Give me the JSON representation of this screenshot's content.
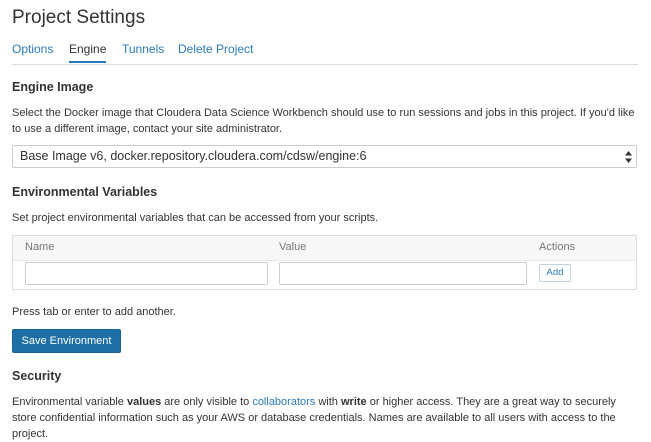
{
  "page": {
    "title": "Project Settings"
  },
  "tabs": [
    {
      "label": "Options",
      "active": false
    },
    {
      "label": "Engine",
      "active": true
    },
    {
      "label": "Tunnels",
      "active": false
    },
    {
      "label": "Delete Project",
      "active": false
    }
  ],
  "engine_image": {
    "heading": "Engine Image",
    "description": "Select the Docker image that Cloudera Data Science Workbench should use to run sessions and jobs in this project. If you'd like to use a different image, contact your site administrator.",
    "selected_value": "Base Image v6, docker.repository.cloudera.com/cdsw/engine:6"
  },
  "env_vars": {
    "heading": "Environmental Variables",
    "description": "Set project environmental variables that can be accessed from your scripts.",
    "columns": {
      "name": "Name",
      "value": "Value",
      "actions": "Actions"
    },
    "name_input_value": "",
    "value_input_value": "",
    "add_label": "Add",
    "hint": "Press tab or enter to add another.",
    "save_label": "Save Environment"
  },
  "security": {
    "heading": "Security",
    "text_1": "Environmental variable ",
    "bold_1": "values",
    "text_2": " are only visible to ",
    "link": "collaborators",
    "text_3": " with ",
    "bold_2": "write",
    "text_4": " or higher access. They are a great way to securely store confidential information such as your AWS or database credentials. Names are available to all users with access to the project."
  },
  "colors": {
    "link": "#2a7ab8",
    "primary_button": "#1d6fa5",
    "text": "#333333",
    "border": "#dddddd"
  },
  "icons": {
    "select_arrows": "sort-arrows-icon"
  }
}
